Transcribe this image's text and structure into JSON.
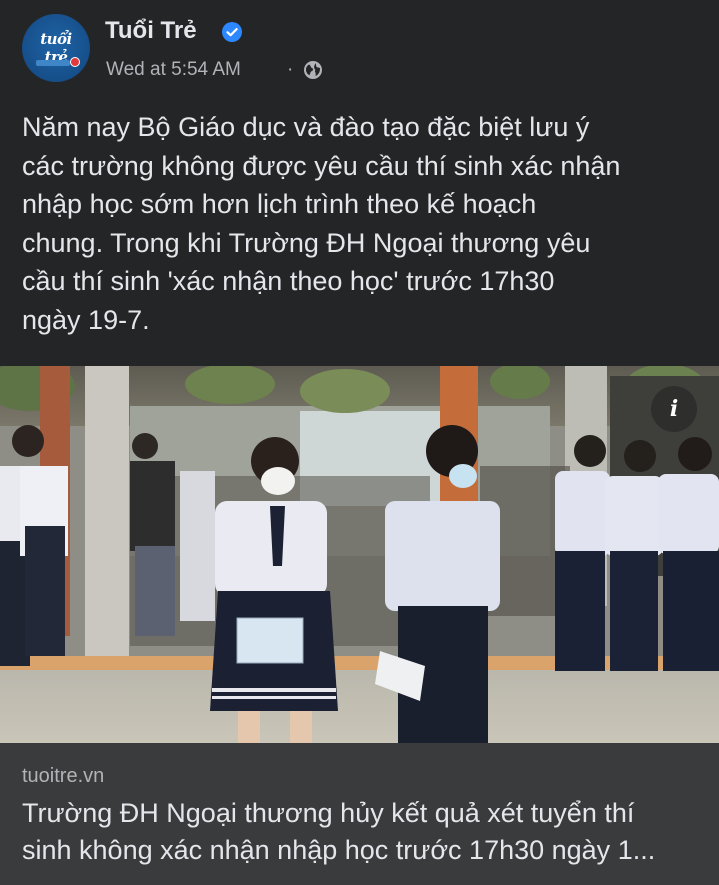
{
  "header": {
    "page_name": "Tuổi Trẻ",
    "timestamp": "Wed at 5:54 AM",
    "separator": "·",
    "verified_icon": "verified-badge-icon",
    "audience_icon": "globe-icon",
    "avatar_text": "tuổi trẻ",
    "accent_color": "#2d88ff"
  },
  "post": {
    "text": "Năm nay Bộ Giáo dục và đào tạo đặc biệt lưu ý\ncác trường không được yêu cầu thí sinh xác nhận\nnhập học sớm hơn lịch trình theo kế hoạch\nchung. Trong khi Trường ĐH Ngoại thương yêu\ncầu thí sinh 'xác nhận theo học' trước 17h30\nngày 19-7."
  },
  "photo": {
    "info_label": "i"
  },
  "link": {
    "domain": "tuoitre.vn",
    "title": "Trường ĐH Ngoại thương hủy kết quả xét tuyển thí\nsinh không xác nhận nhập học trước 17h30 ngày 1..."
  }
}
